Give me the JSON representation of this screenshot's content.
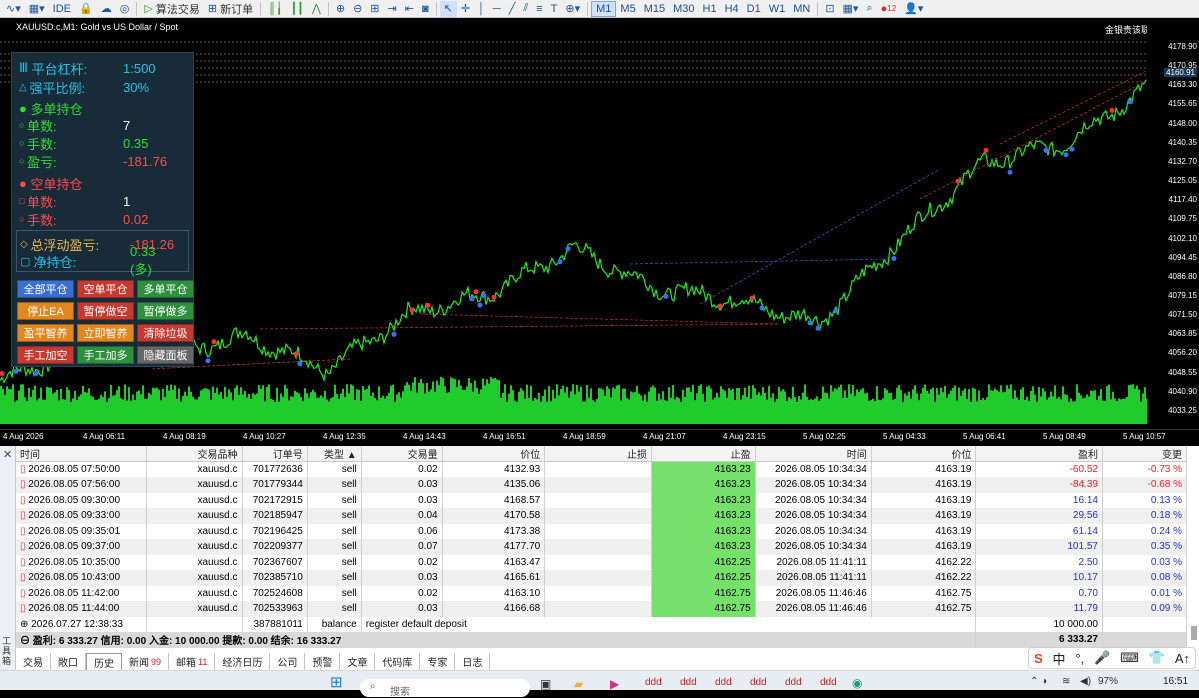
{
  "toolbar": {
    "ide": "IDE",
    "algo_trading": "算法交易",
    "new_order": "新订单",
    "timeframes": [
      "M1",
      "M5",
      "M15",
      "M30",
      "H1",
      "H4",
      "D1",
      "W1",
      "MN"
    ],
    "active_timeframe": "M1",
    "notif_count": "12"
  },
  "chart": {
    "symbol_title": "XAUUSD.c,M1: Gold vs US Dollar / Spot",
    "broker_label": "金银贵该联佐",
    "current_price": "4160.91",
    "price_labels": [
      "4178.90",
      "4170.95",
      "4163.30",
      "4155.65",
      "4148.00",
      "4140.35",
      "4132.70",
      "4125.05",
      "4117.40",
      "4109.75",
      "4102.10",
      "4094.45",
      "4086.80",
      "4079.15",
      "4071.50",
      "4063.85",
      "4056.20",
      "4048.55",
      "4040.90",
      "4033.25"
    ],
    "time_labels": [
      "4 Aug 2026",
      "4 Aug 06:11",
      "4 Aug 08:19",
      "4 Aug 10:27",
      "4 Aug 12:35",
      "4 Aug 14:43",
      "4 Aug 16:51",
      "4 Aug 18:59",
      "4 Aug 21:07",
      "4 Aug 23:15",
      "5 Aug 02:25",
      "5 Aug 04:33",
      "5 Aug 06:41",
      "5 Aug 08:49",
      "5 Aug 10:57"
    ]
  },
  "chart_data": {
    "type": "line",
    "title": "XAUUSD.c,M1: Gold vs US Dollar / Spot",
    "xlabel": "",
    "ylabel": "",
    "ylim": [
      4033.25,
      4178.9
    ],
    "x": [
      "4 Aug 2026",
      "4 Aug 06:11",
      "4 Aug 08:19",
      "4 Aug 10:27",
      "4 Aug 12:35",
      "4 Aug 14:43",
      "4 Aug 16:51",
      "4 Aug 18:59",
      "4 Aug 21:07",
      "4 Aug 23:15",
      "5 Aug 02:25",
      "5 Aug 04:33",
      "5 Aug 06:41",
      "5 Aug 08:49",
      "5 Aug 10:57"
    ],
    "series": [
      {
        "values": [
          4045,
          4058,
          4055,
          4063,
          4049,
          4072,
          4080,
          4098,
          4082,
          4077,
          4068,
          4102,
          4132,
          4140,
          4162
        ]
      }
    ]
  },
  "panel": {
    "leverage_label": "平台杠杆:",
    "leverage_value": "1:500",
    "stopout_label": "强平比例:",
    "stopout_value": "30%",
    "long_title": "多单持仓",
    "long_count_label": "单数:",
    "long_count_value": "7",
    "long_lots_label": "手数:",
    "long_lots_value": "0.35",
    "long_pnl_label": "盈亏:",
    "long_pnl_value": "-181.76",
    "short_title": "空单持仓",
    "short_count_label": "单数:",
    "short_count_value": "1",
    "short_lots_label": "手数:",
    "short_lots_value": "0.02",
    "float_label": "总浮动盈亏:",
    "float_value": "-181.26",
    "net_label": "净持仓:",
    "net_value": "0.33 (多)",
    "buttons": [
      {
        "label": "全部平仓",
        "color": "#3a6fd0"
      },
      {
        "label": "空单平仓",
        "color": "#c53a30"
      },
      {
        "label": "多单平仓",
        "color": "#2e8f3d"
      },
      {
        "label": "停止EA",
        "color": "#e2861f"
      },
      {
        "label": "暂停做空",
        "color": "#c53a30"
      },
      {
        "label": "暂停做多",
        "color": "#2e8f3d"
      },
      {
        "label": "盈平智养",
        "color": "#e2861f"
      },
      {
        "label": "立即智养",
        "color": "#e2861f"
      },
      {
        "label": "清除垃圾",
        "color": "#c53a30"
      },
      {
        "label": "手工加空",
        "color": "#c53a30"
      },
      {
        "label": "手工加多",
        "color": "#2e8f3d"
      },
      {
        "label": "隐藏面板",
        "color": "#666666"
      }
    ]
  },
  "table": {
    "headers": [
      "时间",
      "交易品种",
      "订单号",
      "类型",
      "交易量",
      "价位",
      "止损",
      "止盈",
      "时间",
      "价位",
      "盈利",
      "变更"
    ],
    "rows": [
      [
        "2026.08.05 07:50:00",
        "xauusd.c",
        "701772636",
        "sell",
        "0.02",
        "4132.93",
        "",
        "4163.23",
        "2026.08.05 10:34:34",
        "4163.19",
        "-60.52",
        "-0.73 %"
      ],
      [
        "2026.08.05 07:56:00",
        "xauusd.c",
        "701779344",
        "sell",
        "0.03",
        "4135.06",
        "",
        "4163.23",
        "2026.08.05 10:34:34",
        "4163.19",
        "-84.39",
        "-0.68 %"
      ],
      [
        "2026.08.05 09:30:00",
        "xauusd.c",
        "702172915",
        "sell",
        "0.03",
        "4168.57",
        "",
        "4163.23",
        "2026.08.05 10:34:34",
        "4163.19",
        "16.14",
        "0.13 %"
      ],
      [
        "2026.08.05 09:33:00",
        "xauusd.c",
        "702185947",
        "sell",
        "0.04",
        "4170.58",
        "",
        "4163.23",
        "2026.08.05 10:34:34",
        "4163.19",
        "29.56",
        "0.18 %"
      ],
      [
        "2026.08.05 09:35:01",
        "xauusd.c",
        "702196425",
        "sell",
        "0.06",
        "4173.38",
        "",
        "4163.23",
        "2026.08.05 10:34:34",
        "4163.19",
        "61.14",
        "0.24 %"
      ],
      [
        "2026.08.05 09:37:00",
        "xauusd.c",
        "702209377",
        "sell",
        "0.07",
        "4177.70",
        "",
        "4163.23",
        "2026.08.05 10:34:34",
        "4163.19",
        "101.57",
        "0.35 %"
      ],
      [
        "2026.08.05 10:35:00",
        "xauusd.c",
        "702367607",
        "sell",
        "0.02",
        "4163.47",
        "",
        "4162.25",
        "2026.08.05 11:41:11",
        "4162.22",
        "2.50",
        "0.03 %"
      ],
      [
        "2026.08.05 10:43:00",
        "xauusd.c",
        "702385710",
        "sell",
        "0.03",
        "4165.61",
        "",
        "4162.25",
        "2026.08.05 11:41:11",
        "4162.22",
        "10.17",
        "0.08 %"
      ],
      [
        "2026.08.05 11:42:00",
        "xauusd.c",
        "702524608",
        "sell",
        "0.02",
        "4163.10",
        "",
        "4162.75",
        "2026.08.05 11:46:46",
        "4162.75",
        "0.70",
        "0.01 %"
      ],
      [
        "2026.08.05 11:44:00",
        "xauusd.c",
        "702533963",
        "sell",
        "0.03",
        "4166.68",
        "",
        "4162.75",
        "2026.08.05 11:46:46",
        "4162.75",
        "11.79",
        "0.09 %"
      ]
    ],
    "balance_row": {
      "time": "2026.07.27 12:38:33",
      "order": "387881011",
      "type": "balance",
      "comment": "register default deposit",
      "profit": "10 000.00"
    },
    "summary": "盈利: 6 333.27  信用: 0.00  入金: 10 000.00  提款: 0.00  结余: 16 333.27",
    "summary_total": "6 333.27"
  },
  "side_label": "工具箱",
  "tabs": [
    {
      "label": "交易",
      "badge": ""
    },
    {
      "label": "敞口",
      "badge": ""
    },
    {
      "label": "历史",
      "badge": ""
    },
    {
      "label": "新闻",
      "badge": "99"
    },
    {
      "label": "邮箱",
      "badge": "11"
    },
    {
      "label": "经济日历",
      "badge": ""
    },
    {
      "label": "公司",
      "badge": ""
    },
    {
      "label": "预警",
      "badge": ""
    },
    {
      "label": "文章",
      "badge": ""
    },
    {
      "label": "代码库",
      "badge": ""
    },
    {
      "label": "专家",
      "badge": ""
    },
    {
      "label": "日志",
      "badge": ""
    }
  ],
  "active_tab": "历史",
  "ime": [
    "S",
    "中",
    "°,",
    "🎤",
    "⌨",
    "👕",
    "A↑"
  ],
  "taskbar": {
    "search_placeholder": "搜索",
    "time": "16:51",
    "battery": "97%"
  }
}
